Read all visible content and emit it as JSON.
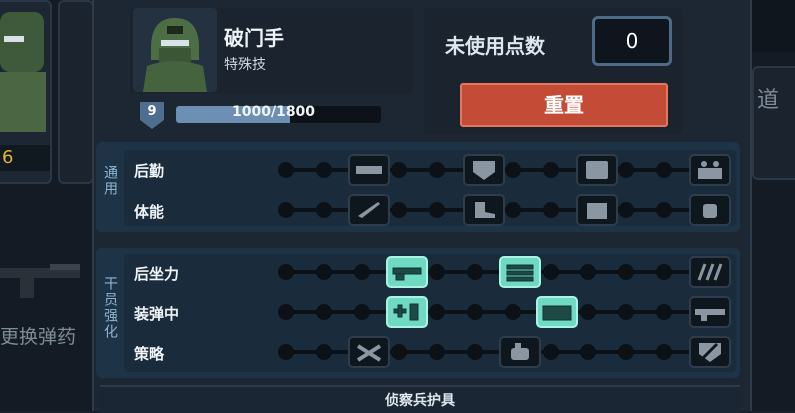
{
  "left_panel": {
    "gold_value": "6",
    "side_text": "更换弹药"
  },
  "right_panel": {
    "side_text": "道"
  },
  "profile": {
    "name": "破门手",
    "subtitle": "特殊技",
    "level": "9",
    "xp_text": "1000/1800",
    "xp_current": 1000,
    "xp_max": 1800
  },
  "points": {
    "label": "未使用点数",
    "value": "0",
    "reset_label": "重置"
  },
  "group_general": {
    "label": "通用",
    "rows": [
      {
        "label": "后勤",
        "slots": [
          {
            "icon": "ammo-belt-icon",
            "active": false
          },
          {
            "icon": "shield-heart-icon",
            "active": false
          },
          {
            "icon": "armor-plate-icon",
            "active": false
          },
          {
            "icon": "crate-icon",
            "active": false
          }
        ]
      },
      {
        "label": "体能",
        "slots": [
          {
            "icon": "knife-icon",
            "active": false
          },
          {
            "icon": "boot-icon",
            "active": false
          },
          {
            "icon": "backpack-icon",
            "active": false
          },
          {
            "icon": "fist-icon",
            "active": false
          }
        ]
      }
    ]
  },
  "group_cadre": {
    "label": "干员强化",
    "rows": [
      {
        "label": "后坐力",
        "slots": [
          {
            "icon": "shotgun-icon",
            "active": true
          },
          {
            "icon": "magazine-icon",
            "active": true
          },
          {
            "icon": "shells-icon",
            "active": false
          }
        ]
      },
      {
        "label": "装弹中",
        "slots": [
          {
            "icon": "medkit-ammo-icon",
            "active": true
          },
          {
            "icon": "ammo-pack-icon",
            "active": true
          },
          {
            "icon": "rifle-icon",
            "active": false
          }
        ]
      },
      {
        "label": "策略",
        "slots": [
          {
            "icon": "tools-icon",
            "active": false
          },
          {
            "icon": "grenade-hand-icon",
            "active": false
          },
          {
            "icon": "shield-slash-icon",
            "active": false
          }
        ]
      }
    ]
  },
  "footer": {
    "label": "侦察兵护具"
  },
  "colors": {
    "accent_teal": "#6fd9c3",
    "reset_red": "#c44b36",
    "gold": "#e3b43a"
  }
}
